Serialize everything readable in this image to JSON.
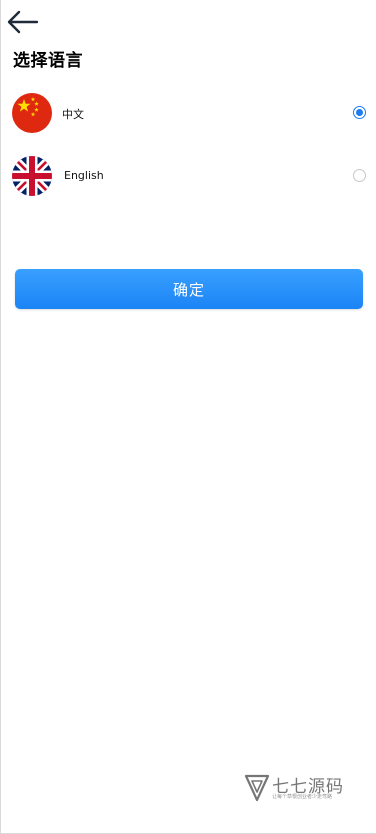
{
  "header": {
    "back_icon": "arrow-left-icon",
    "title": "选择语言"
  },
  "languages": [
    {
      "label": "中文",
      "flag_icon": "china-flag-icon",
      "selected": true
    },
    {
      "label": "English",
      "flag_icon": "uk-flag-icon",
      "selected": false
    }
  ],
  "actions": {
    "confirm_label": "确定"
  },
  "watermark": {
    "logo_icon": "triangle-logo-icon",
    "name": "七七源码",
    "slogan": "让每个草根创业者少走弯路"
  },
  "colors": {
    "accent": "#1f7cf0",
    "button_top": "#39a0ff",
    "button_bottom": "#1b84f5",
    "cn_flag_red": "#de2910",
    "cn_flag_yellow": "#ffde00",
    "uk_flag_blue": "#012169",
    "uk_flag_red": "#c8102e"
  }
}
